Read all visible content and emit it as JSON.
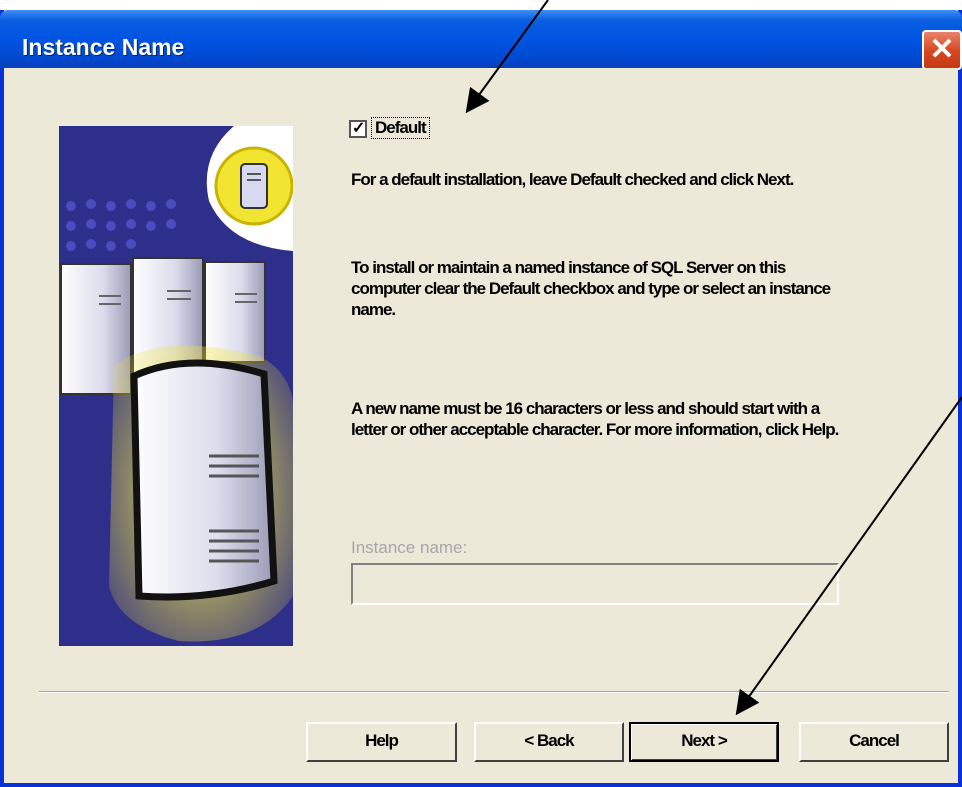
{
  "window": {
    "title": "Instance Name",
    "close_icon": "close-icon"
  },
  "default_checkbox": {
    "checked": true,
    "label": "Default"
  },
  "instructions": {
    "p1": "For a default installation, leave Default checked and click Next.",
    "p2": "To install or maintain a named instance of SQL Server on this computer clear the Default checkbox and type or select an instance name.",
    "p3": "A new name must be 16 characters or less and should start with a letter or other acceptable character.  For more information, click Help."
  },
  "instance_name": {
    "label": "Instance name:",
    "value": "",
    "disabled": true
  },
  "buttons": {
    "help": "Help",
    "back": "< Back",
    "next": "Next >",
    "cancel": "Cancel"
  },
  "colors": {
    "titlebar": "#0054e3",
    "face": "#ece9d8",
    "close": "#d8451f",
    "art_background": "#2e2f8a",
    "art_highlight": "#f2e531"
  },
  "illustration": {
    "icon": "server-illustration"
  }
}
